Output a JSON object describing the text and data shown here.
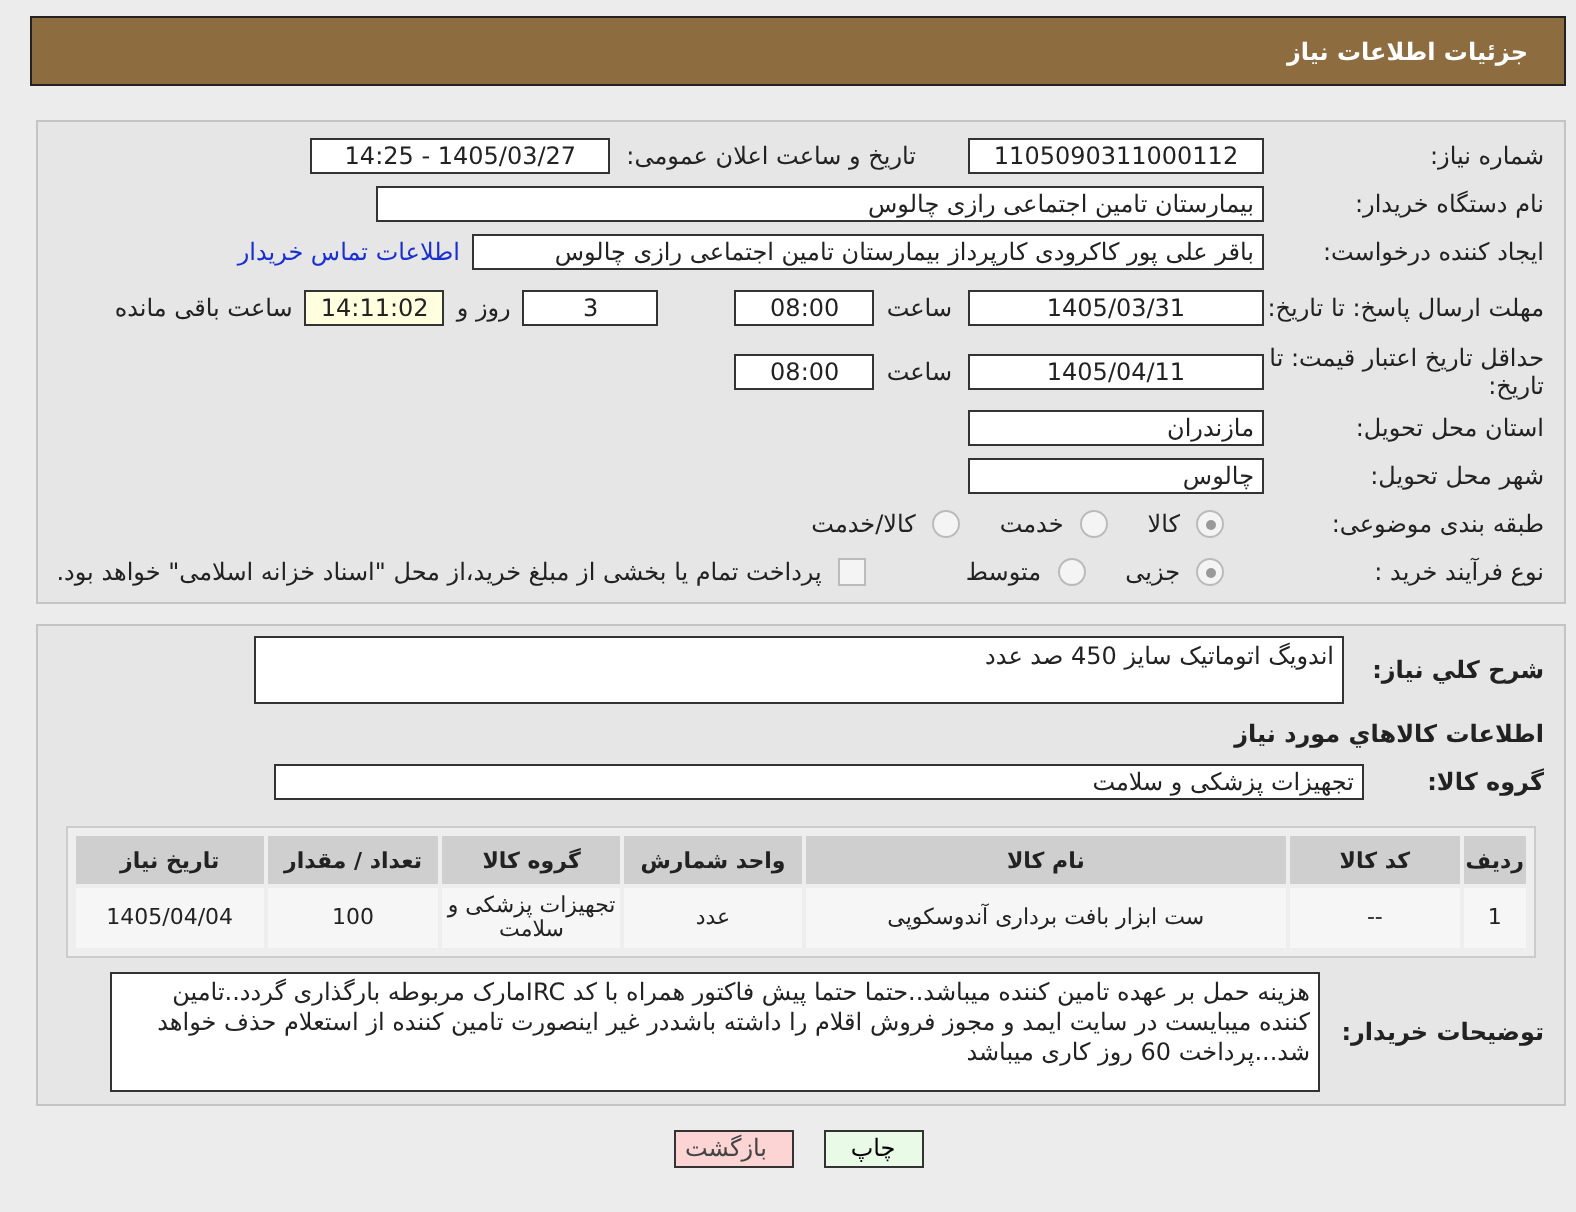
{
  "header": {
    "title": "جزئیات اطلاعات نیاز"
  },
  "need_number": {
    "label": "شماره نیاز:",
    "value": "1105090311000112"
  },
  "announce": {
    "label": "تاریخ و ساعت اعلان عمومی:",
    "value": "1405/03/27 - 14:25"
  },
  "buyer": {
    "label": "نام دستگاه خریدار:",
    "value": "بیمارستان تامین اجتماعی رازی چالوس"
  },
  "requester": {
    "label": "ایجاد کننده درخواست:",
    "value": "باقر علی پور کاکرودی کارپرداز بیمارستان تامین اجتماعی رازی چالوس",
    "link": "اطلاعات تماس خریدار"
  },
  "deadline": {
    "label": "مهلت ارسال پاسخ: تا تاریخ:",
    "date": "1405/03/31",
    "time_label": "ساعت",
    "time": "08:00",
    "days": "3",
    "days_label": "روز و",
    "remaining": "14:11:02",
    "remaining_label": "ساعت باقی مانده"
  },
  "validity": {
    "label": "حداقل تاریخ اعتبار قیمت: تا تاریخ:",
    "date": "1405/04/11",
    "time_label": "ساعت",
    "time": "08:00"
  },
  "province": {
    "label": "استان محل تحویل:",
    "value": "مازندران"
  },
  "city": {
    "label": "شهر محل تحویل:",
    "value": "چالوس"
  },
  "category": {
    "label": "طبقه بندی موضوعی:",
    "options": [
      {
        "label": "کالا",
        "selected": true
      },
      {
        "label": "خدمت",
        "selected": false
      },
      {
        "label": "کالا/خدمت",
        "selected": false
      }
    ]
  },
  "process": {
    "label": "نوع فرآیند خرید :",
    "options": [
      {
        "label": "جزیی",
        "selected": true
      },
      {
        "label": "متوسط",
        "selected": false
      }
    ],
    "payment": {
      "checked": false,
      "text": "پرداخت تمام یا بخشی از مبلغ خرید،از محل \"اسناد خزانه اسلامی\" خواهد بود."
    }
  },
  "description": {
    "label": "شرح کلي نياز:",
    "value": "اندویگ اتوماتیک سایز 450  صد عدد"
  },
  "goods_title": "اطلاعات کالاهاي مورد نياز",
  "group": {
    "label": "گروه کالا:",
    "value": "تجهیزات پزشکی و سلامت"
  },
  "table": {
    "columns": [
      "ردیف",
      "کد کالا",
      "نام کالا",
      "واحد شمارش",
      "گروه کالا",
      "تعداد / مقدار",
      "تاریخ نیاز"
    ],
    "rows": [
      [
        "1",
        "--",
        "ست ابزار بافت برداری آندوسکوپی",
        "عدد",
        "تجهیزات پزشکی و سلامت",
        "100",
        "1405/04/04"
      ]
    ]
  },
  "notes": {
    "label": "توضیحات خریدار:",
    "value": "هزینه حمل بر عهده تامین کننده میباشد..حتما حتما پیش فاکتور همراه با کد IRCمارک مربوطه بارگذاری گردد..تامین کننده میبایست در سایت ایمد و مجوز فروش  اقلام را داشته باشددر غیر اینصورت تامین کننده از استعلام حذف خواهد شد...پرداخت 60 روز کاری میباشد"
  },
  "buttons": [
    {
      "label": "چاپ",
      "kind": "print"
    },
    {
      "label": "بازگشت",
      "kind": "back"
    }
  ]
}
